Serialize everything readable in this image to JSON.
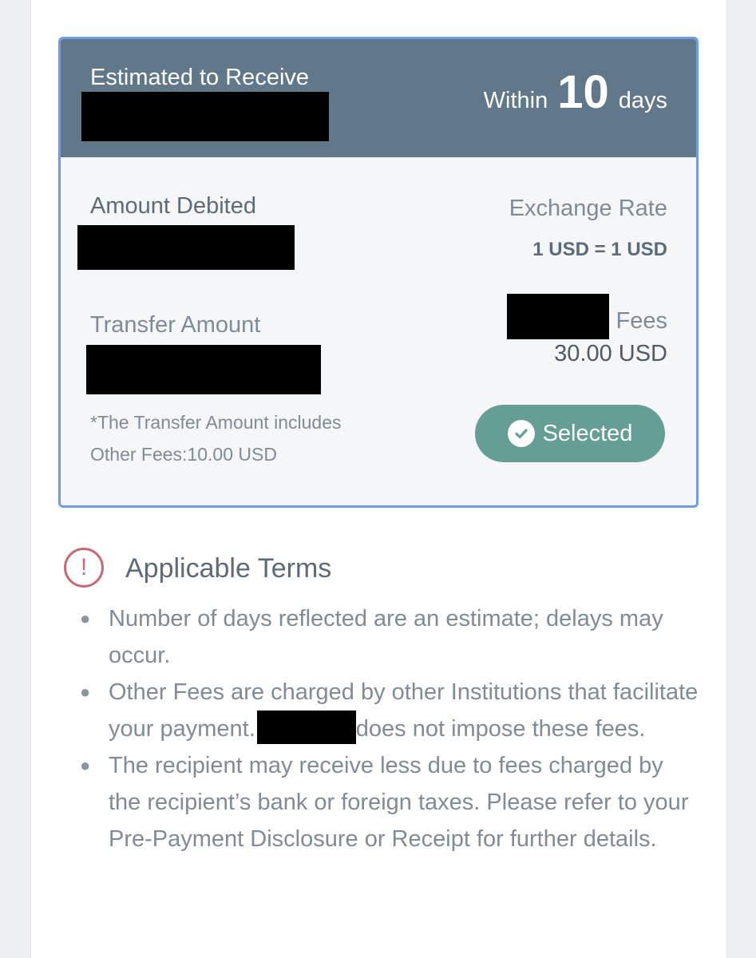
{
  "card": {
    "estimated_label": "Estimated to Receive",
    "within_prefix": "Within",
    "within_days": "10",
    "within_suffix": "days",
    "amount_debited_label": "Amount Debited",
    "exchange_rate_label": "Exchange Rate",
    "exchange_rate_value": "1 USD = 1 USD",
    "transfer_amount_label": "Transfer Amount",
    "fees_label": "Fees",
    "fees_value": "30.00 USD",
    "note_line1": "*The Transfer Amount includes",
    "note_line2": "Other Fees:10.00 USD",
    "selected_label": "Selected"
  },
  "terms": {
    "title": "Applicable Terms",
    "items": [
      {
        "text": "Number of days reflected are an estimate; delays may occur."
      },
      {
        "text_before": "Other Fees are charged by other Institutions that facilitate your payment.",
        "text_after": "does not impose these fees."
      },
      {
        "text": "The recipient may receive less due to fees charged by the recipient’s bank or foreign taxes. Please refer to your Pre-Payment Disclosure or Receipt for further details."
      }
    ]
  },
  "colors": {
    "header_bg": "#61788a",
    "card_border": "#6d9ee3",
    "selected_button": "#649e95",
    "alert_icon": "#c46a7c"
  },
  "icons": {
    "check": "check-circle-icon",
    "alert": "exclamation-circle-icon"
  }
}
